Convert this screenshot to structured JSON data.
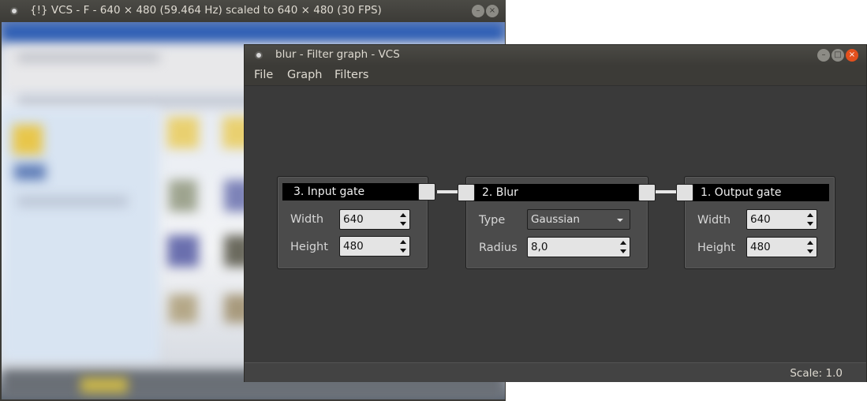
{
  "back_window": {
    "title": "{!} VCS - F - 640 × 480 (59.464 Hz) scaled to 640 × 480 (30 FPS)"
  },
  "front_window": {
    "title": "blur - Filter graph - VCS",
    "menu": [
      "File",
      "Graph",
      "Filters"
    ],
    "nodes": {
      "input_gate": {
        "title": "3. Input gate",
        "width_label": "Width",
        "width_value": "640",
        "height_label": "Height",
        "height_value": "480"
      },
      "blur": {
        "title": "2. Blur",
        "type_label": "Type",
        "type_value": "Gaussian",
        "radius_label": "Radius",
        "radius_value": "8,0"
      },
      "output_gate": {
        "title": "1. Output gate",
        "width_label": "Width",
        "width_value": "640",
        "height_label": "Height",
        "height_value": "480"
      }
    },
    "status": {
      "scale": "Scale: 1.0"
    }
  },
  "icons": {
    "window_menu": "window-menu-icon",
    "minimize": "minimize-icon",
    "maximize": "maximize-icon",
    "close": "close-icon",
    "spin_arrows": "spin-arrows-icon",
    "dropdown": "chevron-down-icon"
  },
  "colors": {
    "close_button": "#e3501d",
    "node_header": "#000000",
    "canvas": "#3a3a3a"
  }
}
